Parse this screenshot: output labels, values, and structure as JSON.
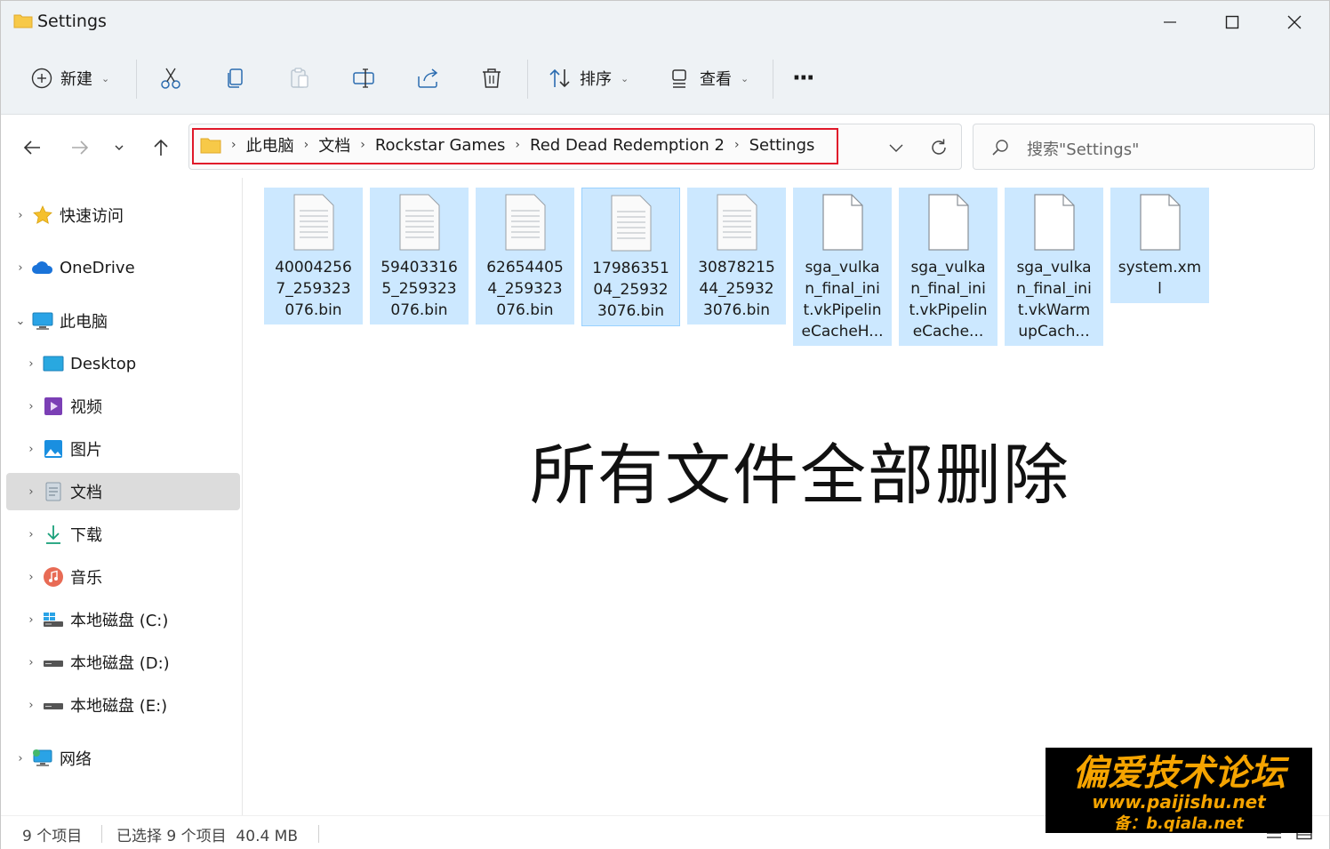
{
  "window": {
    "title": "Settings"
  },
  "toolbar": {
    "new_label": "新建",
    "sort_label": "排序",
    "view_label": "查看",
    "more_label": "···"
  },
  "address": {
    "crumbs": [
      "此电脑",
      "文档",
      "Rockstar Games",
      "Red Dead Redemption 2",
      "Settings"
    ]
  },
  "search": {
    "placeholder": "搜索\"Settings\""
  },
  "sidebar": {
    "items": [
      {
        "label": "快速访问",
        "icon": "star-icon"
      },
      {
        "label": "OneDrive",
        "icon": "cloud-icon"
      },
      {
        "label": "此电脑",
        "icon": "computer-icon"
      },
      {
        "label": "Desktop",
        "icon": "desktop-icon"
      },
      {
        "label": "视频",
        "icon": "video-icon"
      },
      {
        "label": "图片",
        "icon": "pictures-icon"
      },
      {
        "label": "文档",
        "icon": "documents-icon"
      },
      {
        "label": "下载",
        "icon": "download-icon"
      },
      {
        "label": "音乐",
        "icon": "music-icon"
      },
      {
        "label": "本地磁盘 (C:)",
        "icon": "drive-c-icon"
      },
      {
        "label": "本地磁盘 (D:)",
        "icon": "drive-icon"
      },
      {
        "label": "本地磁盘 (E:)",
        "icon": "drive-icon"
      },
      {
        "label": "网络",
        "icon": "network-icon"
      }
    ]
  },
  "files": [
    {
      "name": "400042567_259323076.bin",
      "lines": [
        "40004256",
        "7_259323",
        "076.bin"
      ]
    },
    {
      "name": "594033165_259323076.bin",
      "lines": [
        "59403316",
        "5_259323",
        "076.bin"
      ]
    },
    {
      "name": "626544054_259323076.bin",
      "lines": [
        "62654405",
        "4_259323",
        "076.bin"
      ]
    },
    {
      "name": "1798635104_259323076.bin",
      "lines": [
        "17986351",
        "04_25932",
        "3076.bin"
      ]
    },
    {
      "name": "3087821544_259323076.bin",
      "lines": [
        "30878215",
        "44_25932",
        "3076.bin"
      ]
    },
    {
      "name": "sga_vulkan_final_init.vkPipelineCacheH...",
      "lines": [
        "sga_vulka",
        "n_final_ini",
        "t.vkPipelin",
        "eCacheH..."
      ]
    },
    {
      "name": "sga_vulkan_final_init.vkPipelineCache...",
      "lines": [
        "sga_vulka",
        "n_final_ini",
        "t.vkPipelin",
        "eCache..."
      ]
    },
    {
      "name": "sga_vulkan_final_init.vkWarmupCach...",
      "lines": [
        "sga_vulka",
        "n_final_ini",
        "t.vkWarm",
        "upCach..."
      ]
    },
    {
      "name": "system.xml",
      "lines": [
        "system.xm",
        "l"
      ]
    }
  ],
  "annotation": "所有文件全部删除",
  "status": {
    "count": "9 个项目",
    "selected": "已选择 9 个项目  40.4 MB"
  },
  "watermark": {
    "line1": "偏爱技术论坛",
    "line2": "www.paijishu.net",
    "line3": "备：b.qiala.net"
  },
  "colors": {
    "selection": "#cce8ff",
    "highlight_border": "#e0192a",
    "chrome": "#eef2f5"
  }
}
